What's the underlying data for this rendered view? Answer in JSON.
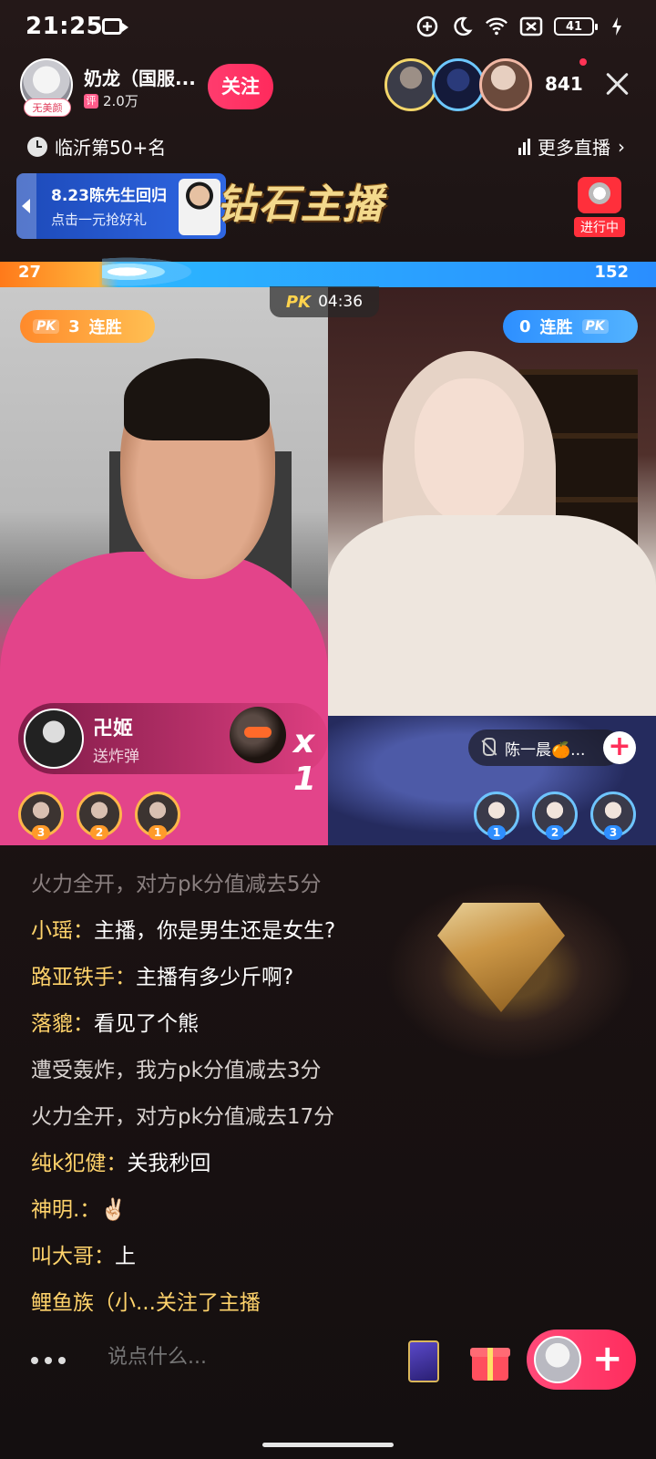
{
  "status_bar": {
    "time": "21:25",
    "battery": "41"
  },
  "header": {
    "host_name": "奶龙（国服...",
    "host_badge": "无美颜",
    "stat_icon": "评",
    "host_followers": "2.0万",
    "follow_label": "关注",
    "viewer_count": "841",
    "rank_text": "临沂第50+名",
    "more_live_label": "更多直播"
  },
  "promo": {
    "title": "8.23陈先生回归",
    "subtitle": "点击一元抢好礼",
    "banner_text": "钻石主播",
    "live_label": "进行中"
  },
  "pk": {
    "left_score": "27",
    "right_score": "152",
    "logo": "PK",
    "timer": "04:36",
    "left_streak_count": "3",
    "right_streak_count": "0",
    "streak_label": "连胜"
  },
  "gift_notice": {
    "user": "卍姬",
    "action": "送炸弹",
    "count": "x 1"
  },
  "guest": {
    "name": "陈一晨🍊..."
  },
  "left_ranks": [
    "3",
    "2",
    "1"
  ],
  "right_ranks": [
    "1",
    "2",
    "3"
  ],
  "chat": [
    {
      "user": "",
      "text": "火力全开，对方pk分值减去5分",
      "style": "faded"
    },
    {
      "user": "小瑶：",
      "text": "主播，你是男生还是女生?",
      "style": "user"
    },
    {
      "user": "路亚铁手：",
      "text": "主播有多少斤啊?",
      "style": "user"
    },
    {
      "user": "落貔：",
      "text": "看见了个熊",
      "style": "user"
    },
    {
      "user": "",
      "text": "遭受轰炸，我方pk分值减去3分",
      "style": "sys"
    },
    {
      "user": "",
      "text": "火力全开，对方pk分值减去17分",
      "style": "sys"
    },
    {
      "user": "纯k犯健：",
      "text": "关我秒回",
      "style": "user"
    },
    {
      "user": "神明.：",
      "text": "✌🏻",
      "style": "user"
    },
    {
      "user": "叫大哥：",
      "text": "上",
      "style": "user"
    },
    {
      "user": "鲤鱼族（小...关注了主播",
      "text": "",
      "style": "user"
    }
  ],
  "bottom": {
    "input_placeholder": "说点什么...",
    "plus_label": "+"
  },
  "colors": {
    "accent": "#ff2d5e",
    "chat_username": "#ffd36b",
    "pk_left": "#ff8a2b",
    "pk_right": "#2d8fff"
  }
}
